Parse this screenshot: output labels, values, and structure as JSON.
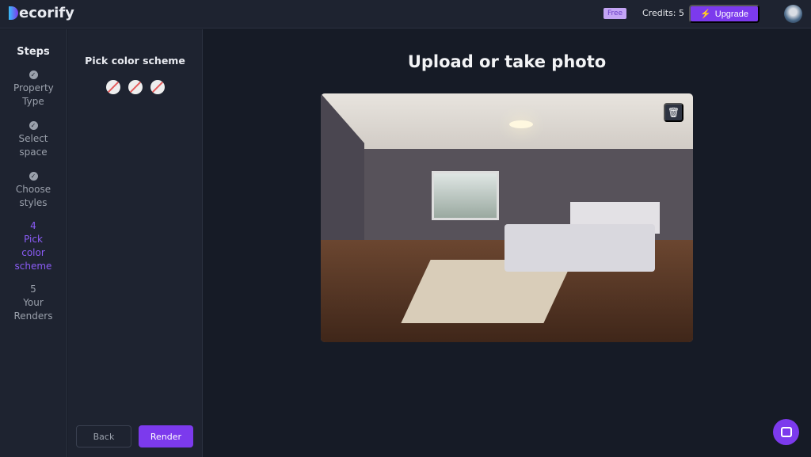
{
  "header": {
    "logo": "ecorify",
    "plan_badge": "Free",
    "credits": "Credits: 5",
    "upgrade_label": "Upgrade"
  },
  "steps": {
    "title": "Steps",
    "items": [
      {
        "number": "",
        "label": "Property Type",
        "done": true
      },
      {
        "number": "",
        "label": "Select space",
        "done": true
      },
      {
        "number": "",
        "label": "Choose styles",
        "done": true
      },
      {
        "number": "4",
        "label": "Pick color scheme",
        "active": true
      },
      {
        "number": "5",
        "label": "Your Renders"
      }
    ]
  },
  "panel": {
    "title": "Pick color scheme",
    "back_label": "Back",
    "render_label": "Render"
  },
  "main": {
    "title": "Upload or take photo"
  },
  "colors": {
    "accent": "#7c3aed",
    "active_step": "#8b5cf6"
  }
}
